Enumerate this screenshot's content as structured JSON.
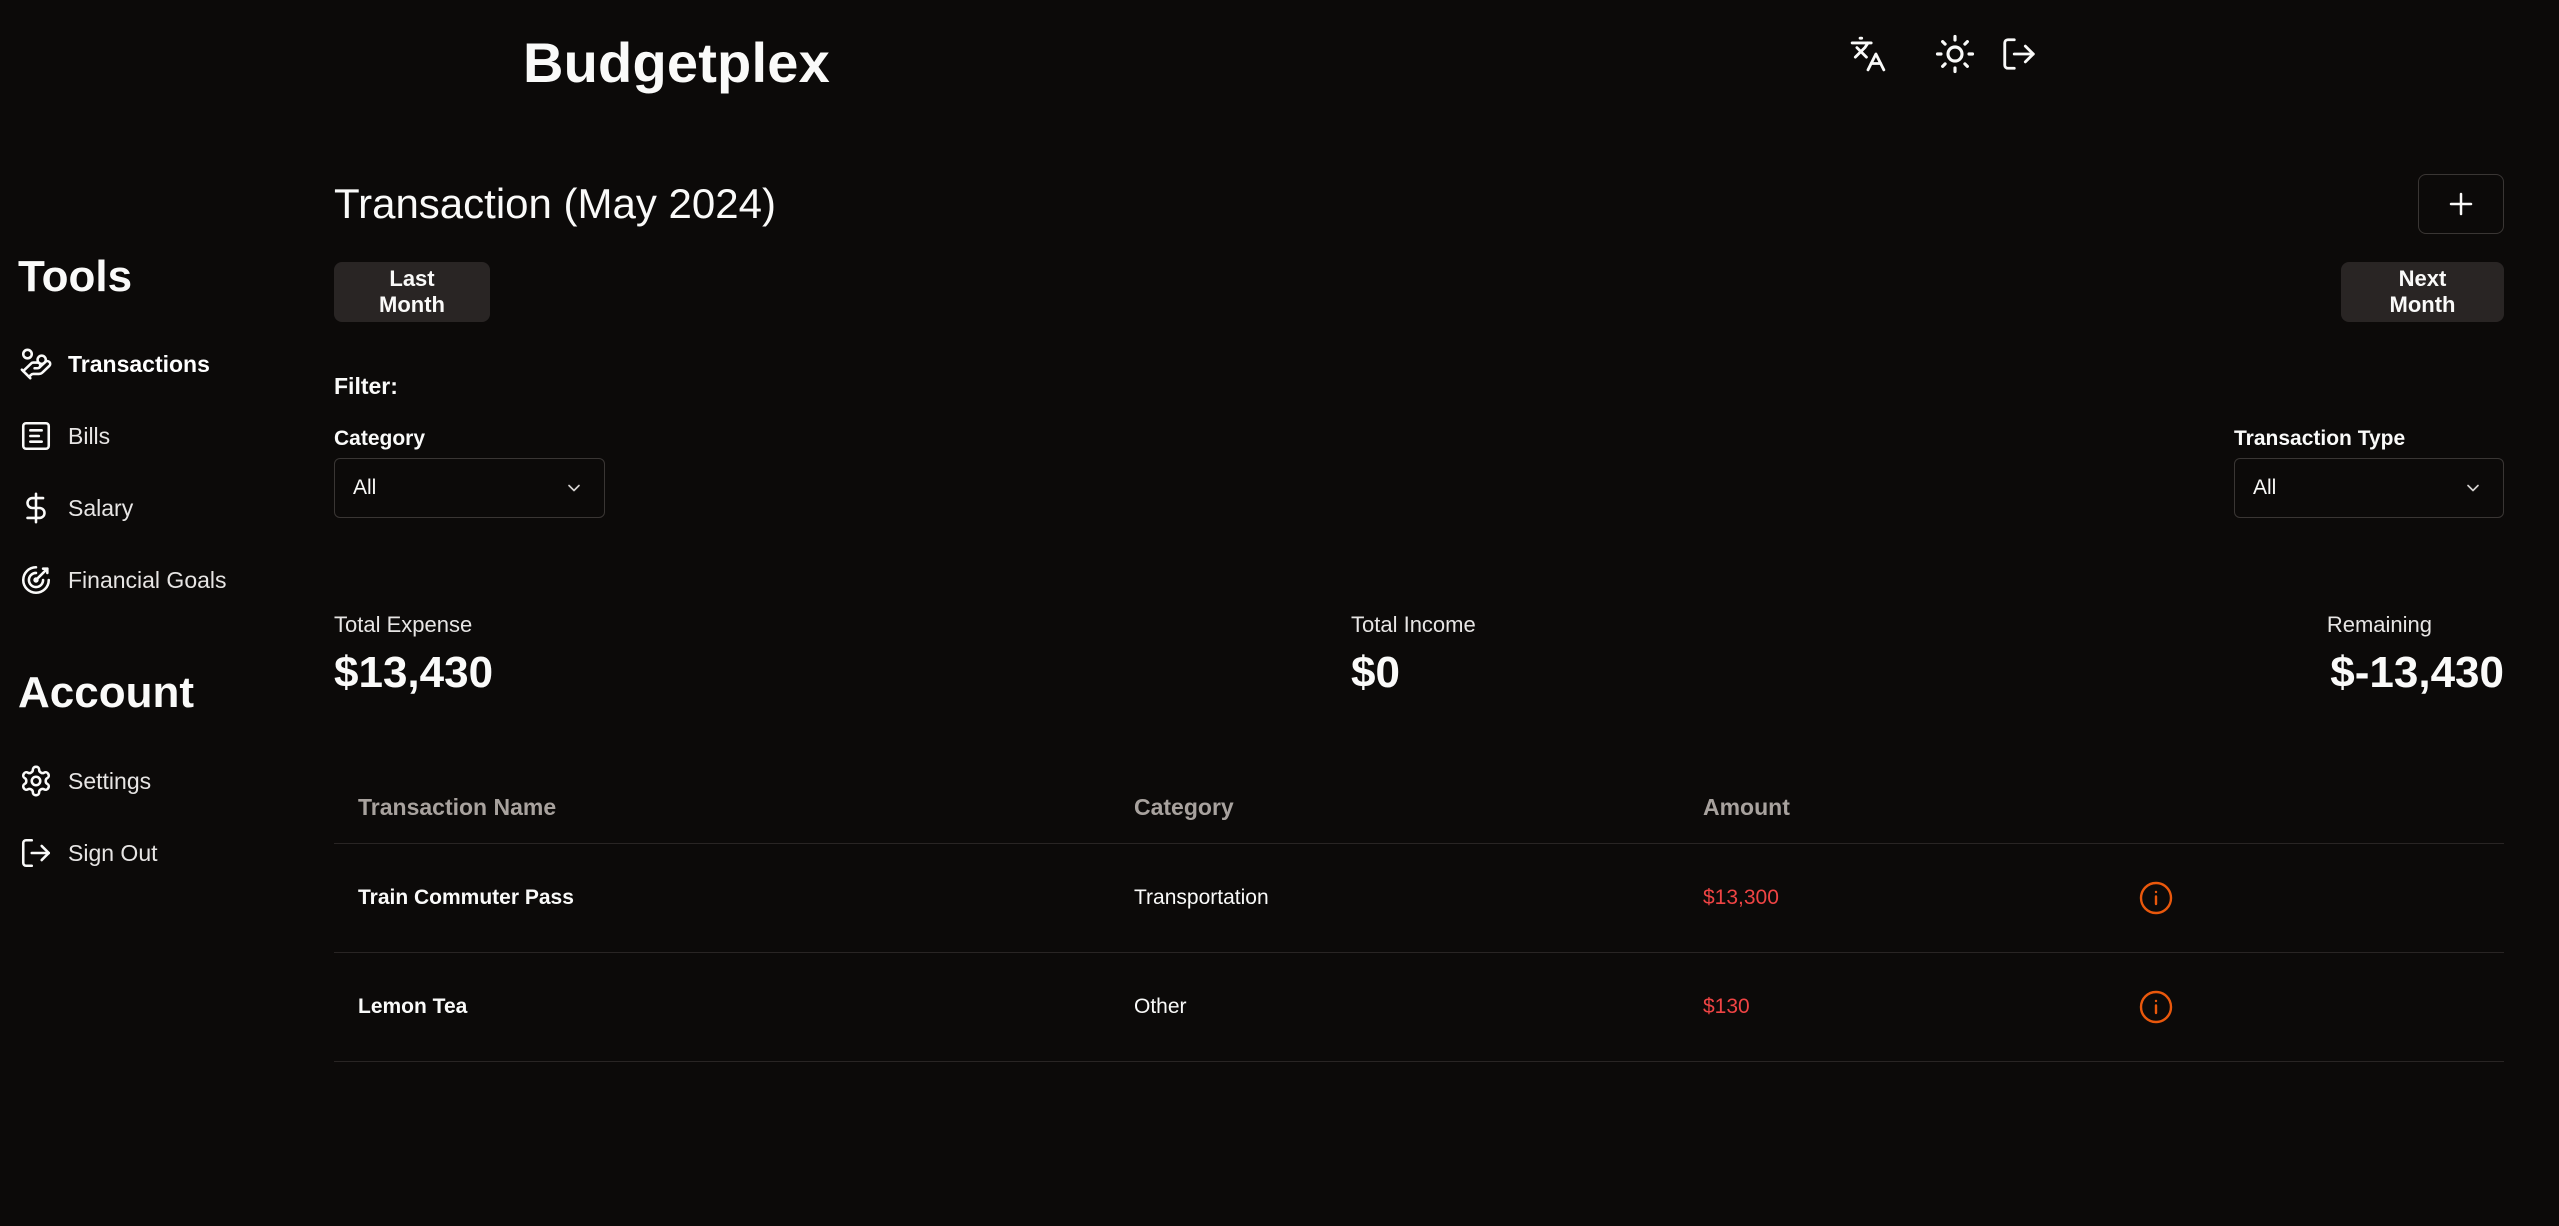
{
  "app": {
    "name": "Budgetplex"
  },
  "header": {
    "icons": [
      "translate-icon",
      "sun-icon",
      "logout-icon"
    ]
  },
  "sidebar": {
    "tools_heading": "Tools",
    "tools": [
      {
        "label": "Transactions",
        "icon": "hand-coins-icon",
        "active": true
      },
      {
        "label": "Bills",
        "icon": "receipt-icon",
        "active": false
      },
      {
        "label": "Salary",
        "icon": "dollar-icon",
        "active": false
      },
      {
        "label": "Financial Goals",
        "icon": "target-icon",
        "active": false
      }
    ],
    "account_heading": "Account",
    "account": [
      {
        "label": "Settings",
        "icon": "gear-icon"
      },
      {
        "label": "Sign Out",
        "icon": "logout-icon"
      }
    ]
  },
  "main": {
    "title": "Transaction (May 2024)",
    "last_month_label": "Last Month",
    "next_month_label": "Next Month",
    "filter_label": "Filter:",
    "category_filter": {
      "label": "Category",
      "value": "All"
    },
    "type_filter": {
      "label": "Transaction Type",
      "value": "All"
    },
    "stats": {
      "expense_label": "Total Expense",
      "expense_value": "$13,430",
      "income_label": "Total Income",
      "income_value": "$0",
      "remaining_label": "Remaining",
      "remaining_value": "$-13,430"
    },
    "table": {
      "columns": [
        "Transaction Name",
        "Category",
        "Amount"
      ],
      "rows": [
        {
          "name": "Train Commuter Pass",
          "category": "Transportation",
          "amount": "$13,300"
        },
        {
          "name": "Lemon Tea",
          "category": "Other",
          "amount": "$130"
        }
      ]
    }
  },
  "colors": {
    "background": "#0c0a09",
    "amount": "#ef4444",
    "info_icon": "#ea580c"
  }
}
